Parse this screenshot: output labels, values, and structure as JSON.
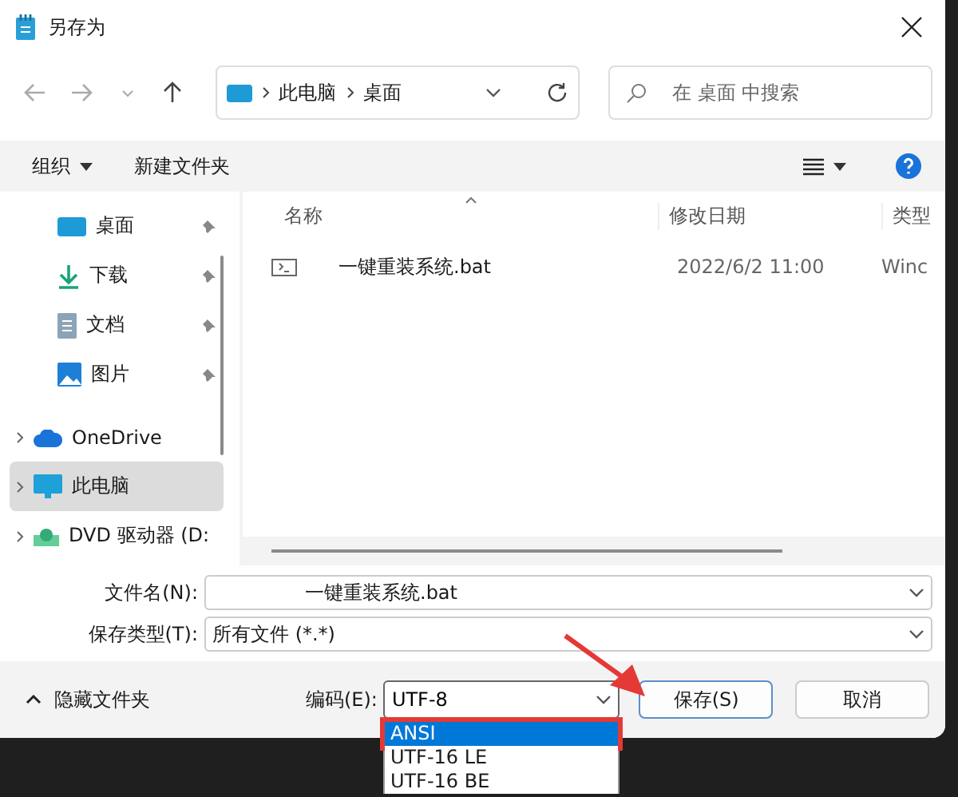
{
  "window": {
    "title": "另存为"
  },
  "nav": {
    "breadcrumb": [
      "此电脑",
      "桌面"
    ],
    "search": {
      "placeholder": "在 桌面 中搜索"
    }
  },
  "toolbar": {
    "organize": "组织",
    "new_folder": "新建文件夹"
  },
  "sidebar": {
    "items": [
      {
        "label": "桌面",
        "pinned": true,
        "expandable": false,
        "selected": false
      },
      {
        "label": "下载",
        "pinned": true,
        "expandable": false,
        "selected": false
      },
      {
        "label": "文档",
        "pinned": true,
        "expandable": false,
        "selected": false
      },
      {
        "label": "图片",
        "pinned": true,
        "expandable": false,
        "selected": false
      },
      {
        "label": "OneDrive",
        "pinned": false,
        "expandable": true,
        "selected": false
      },
      {
        "label": "此电脑",
        "pinned": false,
        "expandable": true,
        "selected": true
      },
      {
        "label": "DVD 驱动器 (D:",
        "pinned": false,
        "expandable": true,
        "selected": false
      }
    ]
  },
  "file_list": {
    "columns": [
      "名称",
      "修改日期",
      "类型"
    ],
    "rows": [
      {
        "name": "一键重装系统.bat",
        "modified": "2022/6/2 11:00",
        "type": "Winc"
      }
    ]
  },
  "form": {
    "file_name": {
      "label": "文件名(N):",
      "value": "一键重装系统.bat"
    },
    "save_type": {
      "label": "保存类型(T):",
      "value": "所有文件 (*.*)"
    }
  },
  "footer": {
    "hide_folders": "隐藏文件夹",
    "encoding": {
      "label": "编码(E):",
      "value": "UTF-8",
      "expanded": true,
      "options": [
        {
          "label": "ANSI",
          "selected": true,
          "annotated": true
        },
        {
          "label": "UTF-16 LE",
          "selected": false,
          "annotated": false
        },
        {
          "label": "UTF-16 BE",
          "selected": false,
          "annotated": false
        }
      ]
    },
    "buttons": [
      "保存(S)",
      "取消"
    ]
  }
}
